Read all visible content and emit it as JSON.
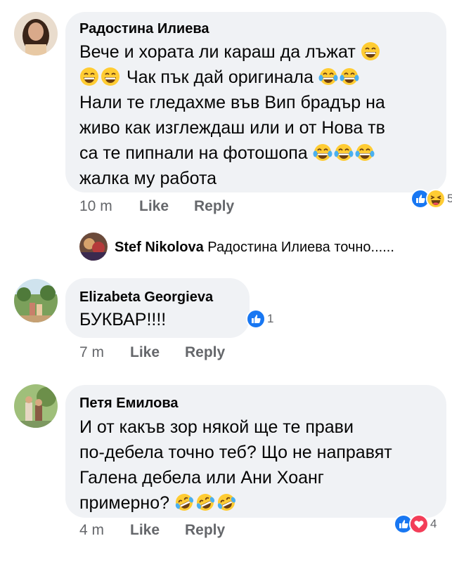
{
  "comments": [
    {
      "author": "Радостина Илиева",
      "lines": [
        "Вече и хората ли караш да лъжат",
        "Чак пък дай оригинала",
        "Нали те гледахме във Вип брадър на",
        "живо как изглеждаш или и от Нова тв",
        "са те пипнали на фотошопа",
        "жалка му работа"
      ],
      "emojis": [
        "grinning-face",
        "grinning-face",
        "grinning-face",
        "tears-of-joy-face",
        "tears-of-joy-face",
        "tears-of-joy-face",
        "tears-of-joy-face",
        "tears-of-joy-face"
      ],
      "time": "10 m",
      "like_label": "Like",
      "reply_label": "Reply",
      "reactions": [
        "like",
        "haha"
      ],
      "reaction_count": "5"
    },
    {
      "author": "Elizabeta Georgieva",
      "lines": [
        "БУКВАР!!!!"
      ],
      "time": "7 m",
      "like_label": "Like",
      "reply_label": "Reply",
      "reactions": [
        "like"
      ],
      "reaction_count": "1"
    },
    {
      "author": "Петя Емилова",
      "lines": [
        "И от какъв зор някой ще те прави",
        "по-дебела точно теб? Що не направят",
        "Галена дебела или Ани Хоанг",
        "примерно?"
      ],
      "emojis": [
        "rolling-laughing-face",
        "rolling-laughing-face",
        "rolling-laughing-face"
      ],
      "time": "4 m",
      "like_label": "Like",
      "reply_label": "Reply",
      "reactions": [
        "like",
        "love"
      ],
      "reaction_count": "4"
    }
  ],
  "reply": {
    "author": "Stef Nikolova",
    "text": "Радостина Илиева точно......"
  },
  "colors": {
    "bubble": "#f0f2f5",
    "meta": "#65676b",
    "like_blue": "#1877f2",
    "love_red": "#f33e58",
    "emoji_yellow": "#ffcc33"
  }
}
